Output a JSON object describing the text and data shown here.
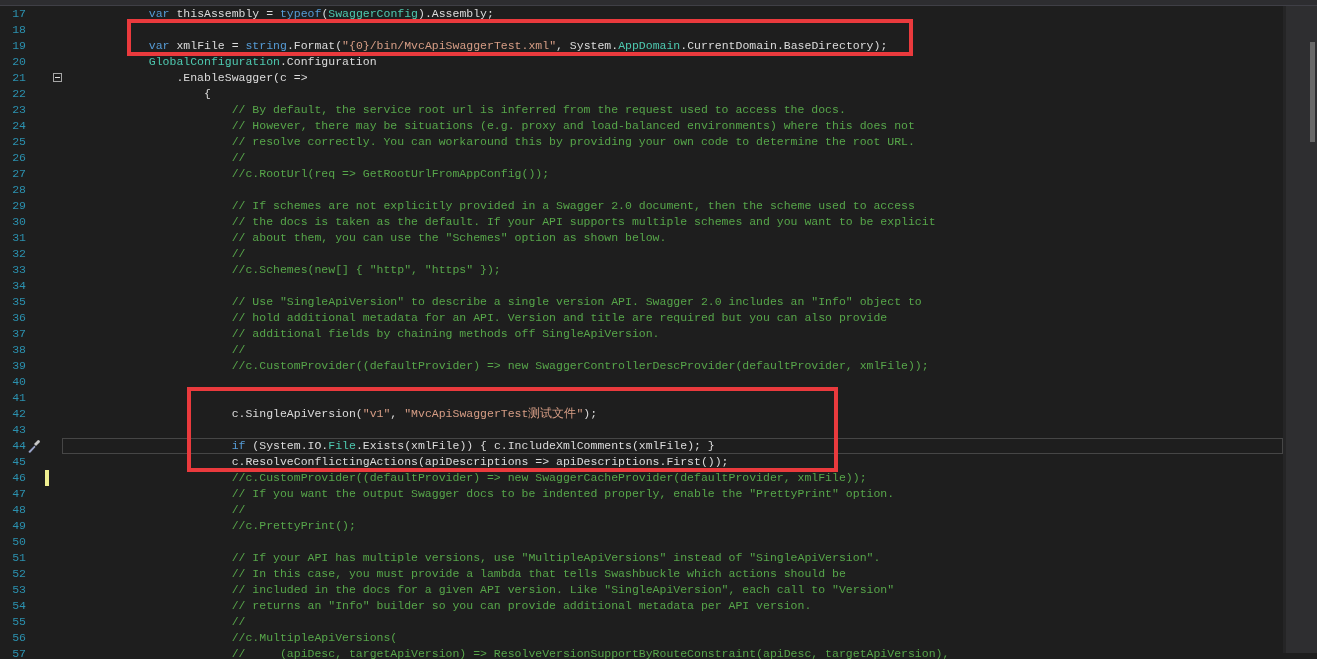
{
  "editor": {
    "sections": [
      {
        "framed": false,
        "lines": [
          {
            "number": "17",
            "code": [
              {
                "kind": "kw",
                "text": "            var"
              },
              {
                "kind": "plain",
                "text": " thisAssembly = "
              },
              {
                "kind": "kw",
                "text": "typeof"
              },
              {
                "kind": "plain",
                "text": "("
              },
              {
                "kind": "type",
                "text": "SwaggerConfig"
              },
              {
                "kind": "plain",
                "text": ").Assembly;"
              }
            ]
          }
        ]
      },
      {
        "framed": true,
        "lines": [
          {
            "number": "18"
          },
          {
            "number": "19",
            "code": [
              {
                "kind": "kw",
                "text": "            var"
              },
              {
                "kind": "plain",
                "text": " xmlFile = "
              },
              {
                "kind": "kw",
                "text": "string"
              },
              {
                "kind": "plain",
                "text": ".Format("
              },
              {
                "kind": "str",
                "text": "\"{0}/bin/MvcApiSwaggerTest.xml\""
              },
              {
                "kind": "plain",
                "text": ", System."
              },
              {
                "kind": "type",
                "text": "AppDomain"
              },
              {
                "kind": "plain",
                "text": ".CurrentDomain.BaseDirectory);"
              }
            ]
          }
        ]
      },
      {
        "framed": false,
        "lines": [
          {
            "number": "20",
            "code": [
              {
                "kind": "type",
                "text": "            GlobalConfiguration"
              },
              {
                "kind": "plain",
                "text": ".Configuration"
              }
            ]
          },
          {
            "number": "21",
            "expanded": true,
            "code": [
              {
                "kind": "plain",
                "text": "                .EnableSwagger(c =>"
              }
            ]
          },
          {
            "number": "22",
            "code": [
              {
                "kind": "plain",
                "text": "                    {"
              }
            ]
          },
          {
            "number": "23",
            "code": [
              {
                "kind": "comment",
                "text": "                        // By default, the service root url is inferred from the request used to access the docs."
              }
            ]
          },
          {
            "number": "24",
            "code": [
              {
                "kind": "comment",
                "text": "                        // However, there may be situations (e.g. proxy and load-balanced environments) where this does not"
              }
            ]
          },
          {
            "number": "25",
            "code": [
              {
                "kind": "comment",
                "text": "                        // resolve correctly. You can workaround this by providing your own code to determine the root URL."
              }
            ]
          },
          {
            "number": "26",
            "code": [
              {
                "kind": "comment",
                "text": "                        //"
              }
            ]
          },
          {
            "number": "27",
            "code": [
              {
                "kind": "comment",
                "text": "                        //c.RootUrl(req => GetRootUrlFromAppConfig());"
              }
            ]
          },
          {
            "number": "28"
          },
          {
            "number": "29",
            "code": [
              {
                "kind": "comment",
                "text": "                        // If schemes are not explicitly provided in a Swagger 2.0 document, then the scheme used to access"
              }
            ]
          },
          {
            "number": "30",
            "code": [
              {
                "kind": "comment",
                "text": "                        // the docs is taken as the default. If your API supports multiple schemes and you want to be explicit"
              }
            ]
          },
          {
            "number": "31",
            "code": [
              {
                "kind": "comment",
                "text": "                        // about them, you can use the \"Schemes\" option as shown below."
              }
            ]
          },
          {
            "number": "32",
            "code": [
              {
                "kind": "comment",
                "text": "                        //"
              }
            ]
          },
          {
            "number": "33",
            "code": [
              {
                "kind": "comment",
                "text": "                        //c.Schemes(new[] { \"http\", \"https\" });"
              }
            ]
          },
          {
            "number": "34"
          },
          {
            "number": "35",
            "code": [
              {
                "kind": "comment",
                "text": "                        // Use \"SingleApiVersion\" to describe a single version API. Swagger 2.0 includes an \"Info\" object to"
              }
            ]
          },
          {
            "number": "36",
            "code": [
              {
                "kind": "comment",
                "text": "                        // hold additional metadata for an API. Version and title are required but you can also provide"
              }
            ]
          },
          {
            "number": "37",
            "code": [
              {
                "kind": "comment",
                "text": "                        // additional fields by chaining methods off SingleApiVersion."
              }
            ]
          },
          {
            "number": "38",
            "code": [
              {
                "kind": "comment",
                "text": "                        //"
              }
            ]
          },
          {
            "number": "39",
            "code": [
              {
                "kind": "comment",
                "text": "                        //c.CustomProvider((defaultProvider) => new SwaggerControllerDescProvider(defaultProvider, xmlFile));"
              }
            ]
          },
          {
            "number": "40"
          }
        ]
      },
      {
        "framed": true,
        "lines": [
          {
            "number": "41"
          },
          {
            "number": "42",
            "code": [
              {
                "kind": "plain",
                "text": "                        c.SingleApiVersion("
              },
              {
                "kind": "str",
                "text": "\"v1\""
              },
              {
                "kind": "plain",
                "text": ", "
              },
              {
                "kind": "str",
                "text": "\"MvcApiSwaggerTest测试文件\""
              },
              {
                "kind": "plain",
                "text": ");"
              }
            ]
          },
          {
            "number": "43"
          },
          {
            "number": "44",
            "current": true,
            "code": [
              {
                "kind": "kw",
                "text": "                        if"
              },
              {
                "kind": "plain",
                "text": " (System.IO."
              },
              {
                "kind": "type",
                "text": "File"
              },
              {
                "kind": "plain",
                "text": ".Exists(xmlFile)) { c.IncludeXmlComments(xmlFile); }"
              }
            ]
          },
          {
            "number": "45",
            "code": [
              {
                "kind": "plain",
                "text": "                        c.ResolveConflictingActions(apiDescriptions => apiDescriptions.First());"
              }
            ]
          }
        ]
      },
      {
        "framed": false,
        "lines": [
          {
            "number": "46",
            "changed": true,
            "code": [
              {
                "kind": "comment",
                "text": "                        //c.CustomProvider((defaultProvider) => new SwaggerCacheProvider(defaultProvider, xmlFile));"
              }
            ]
          },
          {
            "number": "47",
            "code": [
              {
                "kind": "comment",
                "text": "                        // If you want the output Swagger docs to be indented properly, enable the \"PrettyPrint\" option."
              }
            ]
          },
          {
            "number": "48",
            "code": [
              {
                "kind": "comment",
                "text": "                        //"
              }
            ]
          },
          {
            "number": "49",
            "code": [
              {
                "kind": "comment",
                "text": "                        //c.PrettyPrint();"
              }
            ]
          },
          {
            "number": "50"
          },
          {
            "number": "51",
            "code": [
              {
                "kind": "comment",
                "text": "                        // If your API has multiple versions, use \"MultipleApiVersions\" instead of \"SingleApiVersion\"."
              }
            ]
          },
          {
            "number": "52",
            "code": [
              {
                "kind": "comment",
                "text": "                        // In this case, you must provide a lambda that tells Swashbuckle which actions should be"
              }
            ]
          },
          {
            "number": "53",
            "code": [
              {
                "kind": "comment",
                "text": "                        // included in the docs for a given API version. Like \"SingleApiVersion\", each call to \"Version\""
              }
            ]
          },
          {
            "number": "54",
            "code": [
              {
                "kind": "comment",
                "text": "                        // returns an \"Info\" builder so you can provide additional metadata per API version."
              }
            ]
          },
          {
            "number": "55",
            "code": [
              {
                "kind": "comment",
                "text": "                        //"
              }
            ]
          },
          {
            "number": "56",
            "code": [
              {
                "kind": "comment",
                "text": "                        //c.MultipleApiVersions("
              }
            ]
          },
          {
            "number": "57",
            "code": [
              {
                "kind": "comment",
                "text": "                        //     (apiDesc, targetApiVersion) => ResolveVersionSupportByRouteConstraint(apiDesc, targetApiVersion),"
              }
            ]
          }
        ]
      }
    ]
  }
}
